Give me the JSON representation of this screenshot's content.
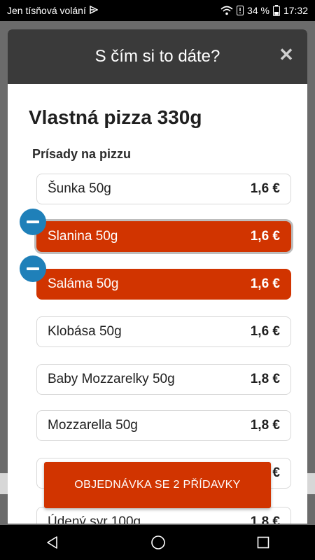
{
  "status_bar": {
    "carrier": "Jen tísňová volání",
    "battery": "34 %",
    "time": "17:32"
  },
  "modal": {
    "title": "S čím si to dáte?",
    "close_icon": "close-icon",
    "product_title": "Vlastná pizza 330g",
    "section_title": "Prísady na pizzu",
    "ingredients": [
      {
        "name": "Šunka 50g",
        "price": "1,6 €",
        "selected": false
      },
      {
        "name": "Slanina 50g",
        "price": "1,6 €",
        "selected": true
      },
      {
        "name": "Saláma 50g",
        "price": "1,6 €",
        "selected": true
      },
      {
        "name": "Klobása 50g",
        "price": "1,6 €",
        "selected": false
      },
      {
        "name": "Baby Mozzarelky 50g",
        "price": "1,8 €",
        "selected": false
      },
      {
        "name": "Mozzarella 50g",
        "price": "1,8 €",
        "selected": false
      },
      {
        "name": "",
        "price": "€",
        "selected": false
      },
      {
        "name": "Údený syr 100g",
        "price": "1,8 €",
        "selected": false
      }
    ]
  },
  "order_button": {
    "label": "OBJEDNÁVKA SE 2 PŘÍDAVKY"
  },
  "colors": {
    "accent": "#d13400",
    "remove_badge": "#1f80b9",
    "header": "#3a3a3a"
  },
  "nav_bar": {
    "icons": [
      "back-icon",
      "home-icon",
      "recents-icon"
    ]
  }
}
